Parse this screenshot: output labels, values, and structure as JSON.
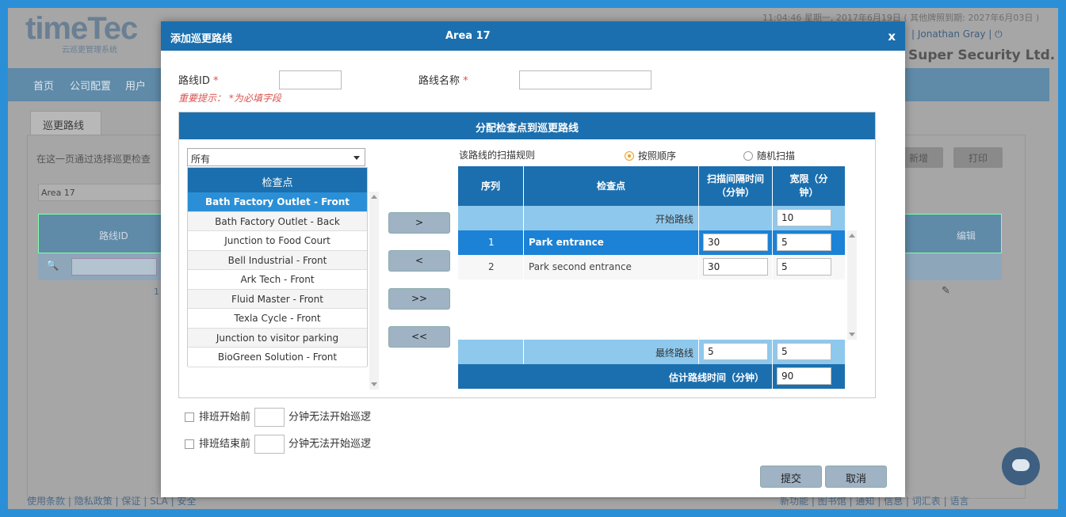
{
  "bg": {
    "logo": "timeTec",
    "logo_sub": "云巡更管理系统",
    "top_info": "11:04:46 星期一, 2017年6月19日 ( 其他牌照到期: 2027年6月03日 )",
    "user": "Jonathan Gray",
    "company": "Super Security Ltd.",
    "nav": [
      "首页",
      "公司配置",
      "用户"
    ],
    "tab": "巡更路线",
    "desc": "在这一页通过选择巡更检查",
    "area_select": "Area 17",
    "col_route_id": "路线ID",
    "col_edit": "编辑",
    "row_id": "1",
    "btn_new": "新增",
    "btn_print": "打印",
    "footer_left": [
      "使用条款",
      "隐私政策",
      "保证",
      "SLA",
      "安全"
    ],
    "footer_right": [
      "新功能",
      "图书馆",
      "通知",
      "信息",
      "词汇表",
      "语言"
    ]
  },
  "modal": {
    "title": "添加巡更路线",
    "area": "Area 17",
    "close": "x",
    "route_id_label": "路线ID",
    "route_name_label": "路线名称",
    "required_mark": "*",
    "hint": "重要提示： *为必填字段",
    "assign_header": "分配检查点到巡更路线",
    "filter_value": "所有",
    "checkpoint_header": "检查点",
    "checkpoints": [
      "Bath Factory Outlet - Front",
      "Bath Factory Outlet - Back",
      "Junction to Food Court",
      "Bell Industrial - Front",
      "Ark Tech - Front",
      "Fluid Master - Front",
      "Texla Cycle - Front",
      "Junction to visitor parking",
      "BioGreen Solution - Front"
    ],
    "move_buttons": [
      ">",
      "<",
      ">>",
      "<<"
    ],
    "scan_rule_label": "该路线的扫描规则",
    "radio_order": "按照顺序",
    "radio_random": "随机扫描",
    "table_headers": {
      "seq": "序列",
      "checkpoint": "检查点",
      "interval": "扫描间隔时间（分钟）",
      "tolerance": "宽限（分钟）"
    },
    "start_label": "开始路线",
    "start_tolerance": "10",
    "rows": [
      {
        "seq": "1",
        "name": "Park entrance",
        "interval": "30",
        "tolerance": "5"
      },
      {
        "seq": "2",
        "name": "Park second entrance",
        "interval": "30",
        "tolerance": "5"
      }
    ],
    "end_label": "最终路线",
    "end_interval": "5",
    "end_tolerance": "5",
    "est_label": "估计路线时间（分钟）",
    "est_value": "90",
    "check_before_start": "排班开始前",
    "check_before_end": "排班结束前",
    "check_suffix": "分钟无法开始巡逻",
    "submit": "提交",
    "cancel": "取消"
  }
}
